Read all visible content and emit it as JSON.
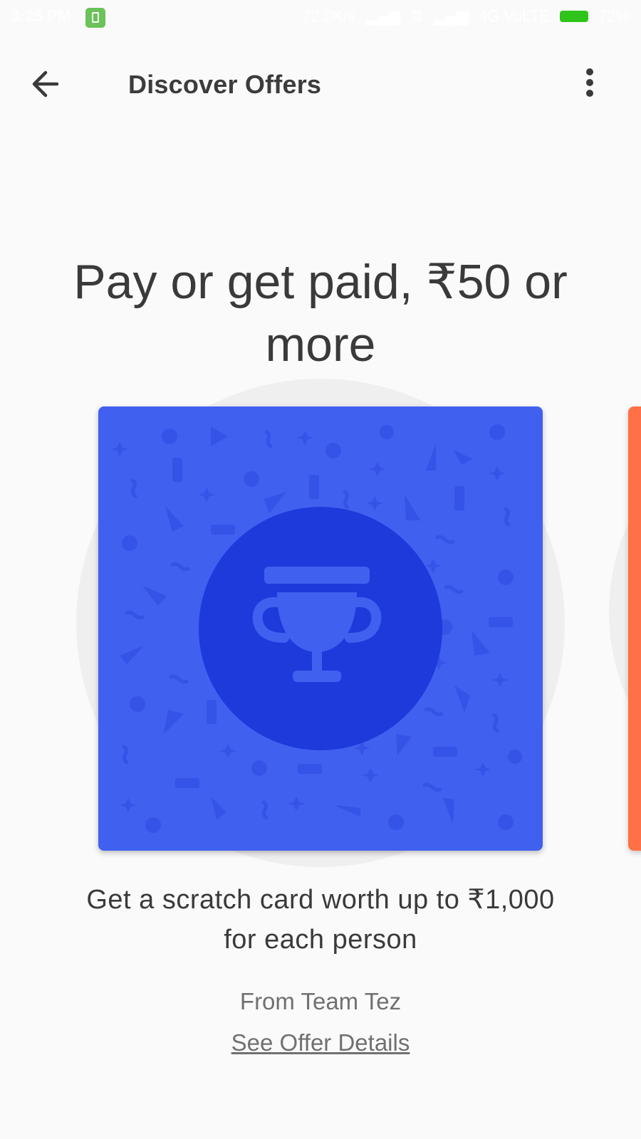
{
  "status_bar": {
    "time": "3:25 PM",
    "network_speed": "72.0K/s",
    "network_type": "4G VoLTE",
    "battery_percent": "72%"
  },
  "app_bar": {
    "title": "Discover Offers"
  },
  "offer": {
    "headline": "Pay or get paid, ₹50 or more",
    "description": "Get a scratch card worth up to ₹1,000 for each person",
    "from": "From Team Tez",
    "details_link": "See Offer Details"
  },
  "colors": {
    "card_blue": "#4060f0",
    "trophy_circle": "#1e3adb",
    "next_card_orange": "#ff7046",
    "battery_green": "#2ec41a"
  },
  "icons": {
    "back": "arrow-back-icon",
    "more": "more-vert-icon",
    "trophy": "trophy-icon"
  }
}
